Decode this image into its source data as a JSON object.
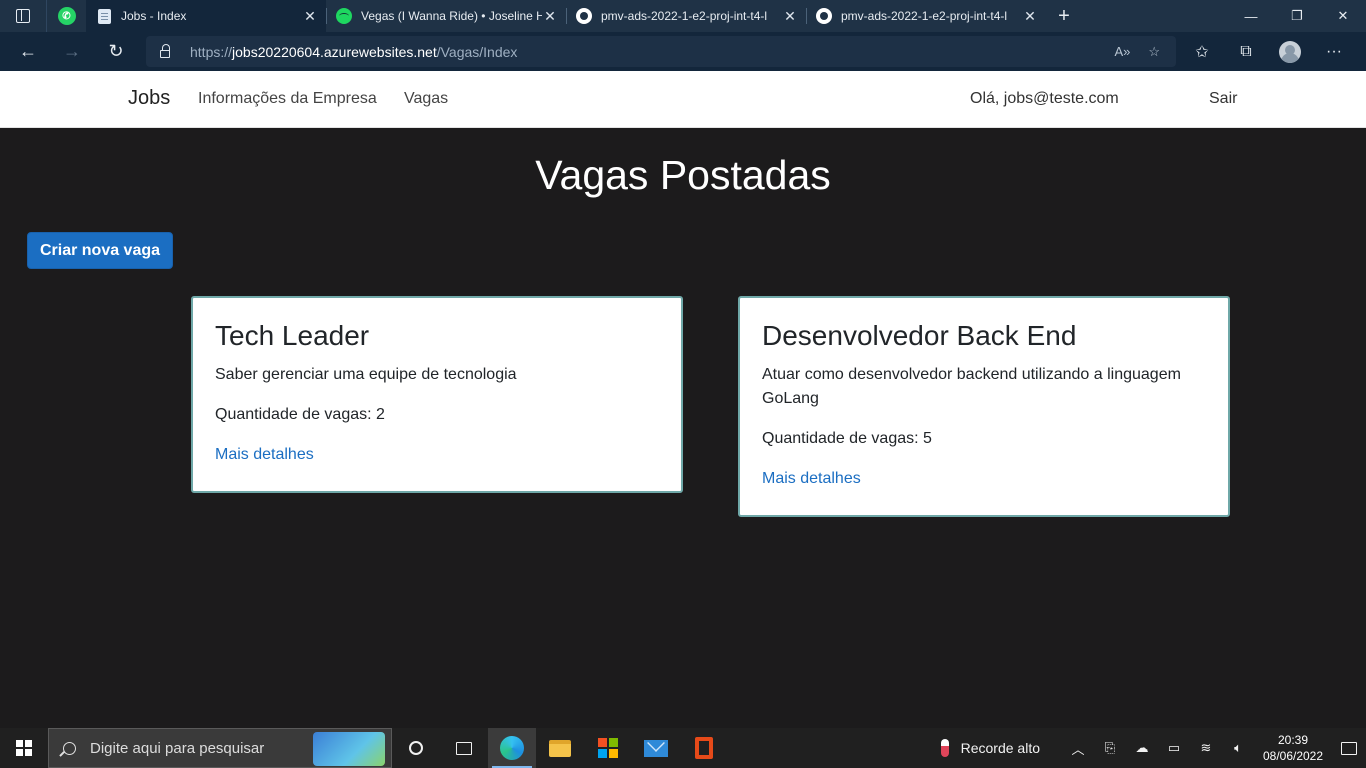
{
  "browser": {
    "tabs": [
      {
        "title": "Jobs - Index",
        "icon": "document-icon",
        "active": true
      },
      {
        "title": "Vegas (I Wanna Ride) • Joseline H",
        "icon": "spotify-icon",
        "active": false
      },
      {
        "title": "pmv-ads-2022-1-e2-proj-int-t4-l",
        "icon": "github-icon",
        "active": false
      },
      {
        "title": "pmv-ads-2022-1-e2-proj-int-t4-l",
        "icon": "github-icon",
        "active": false
      }
    ],
    "url": {
      "scheme": "https://",
      "host": "jobs20220604.azurewebsites.net",
      "path": "/Vagas/Index"
    }
  },
  "navbar": {
    "brand": "Jobs",
    "links": [
      "Informações da Empresa",
      "Vagas"
    ],
    "greeting": "Olá, jobs@teste.com",
    "logout": "Sair"
  },
  "page": {
    "title": "Vagas Postadas",
    "create_button": "Criar nova vaga",
    "cards": [
      {
        "title": "Tech Leader",
        "description": "Saber gerenciar uma equipe de tecnologia",
        "quantity": "Quantidade de vagas: 2",
        "link": "Mais detalhes"
      },
      {
        "title": "Desenvolvedor Back End",
        "description": "Atuar como desenvolvedor backend utilizando a linguagem GoLang",
        "quantity": "Quantidade de vagas: 5",
        "link": "Mais detalhes"
      }
    ]
  },
  "taskbar": {
    "search_placeholder": "Digite aqui para pesquisar",
    "weather": "Recorde alto",
    "time": "20:39",
    "date": "08/06/2022"
  },
  "colors": {
    "accent": "#1b6ec2",
    "page_background": "#1c1b1c",
    "card_border": "#6fa8a8"
  }
}
